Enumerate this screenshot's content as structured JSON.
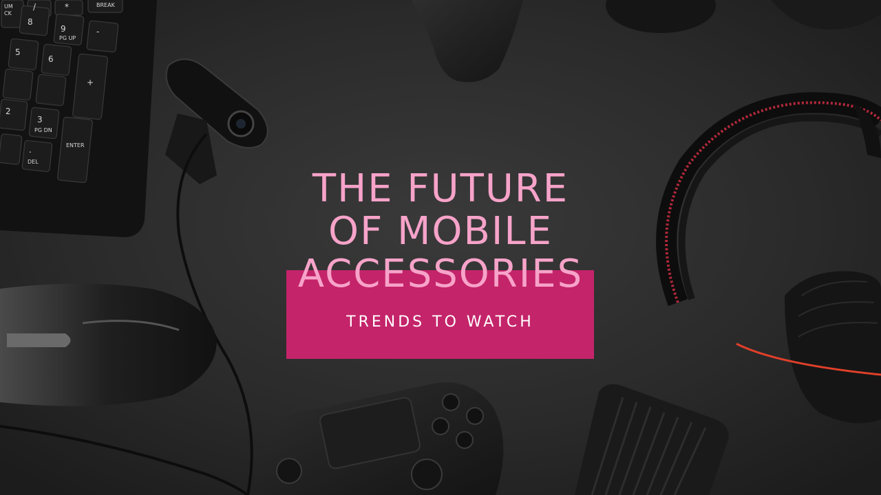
{
  "slide": {
    "title_lines": [
      "THE FUTURE",
      "OF MOBILE",
      "ACCESSORIES"
    ],
    "subtitle": "TRENDS TO WATCH"
  },
  "colors": {
    "accent": "#c4246a",
    "title_text": "#f7a3c9",
    "background": "#262626"
  },
  "keyboard": {
    "keys": [
      "BREAK",
      "UM",
      "CK",
      "/",
      "*",
      "-",
      "8",
      "9",
      "PG UP",
      "+",
      "5",
      "6",
      "2",
      "3",
      "PG DN",
      "ENTER",
      ".",
      "DEL"
    ]
  },
  "photo_objects": [
    "keyboard",
    "webcam",
    "mouse",
    "gamepad",
    "headphones",
    "external-drive",
    "controller-top",
    "cable"
  ]
}
